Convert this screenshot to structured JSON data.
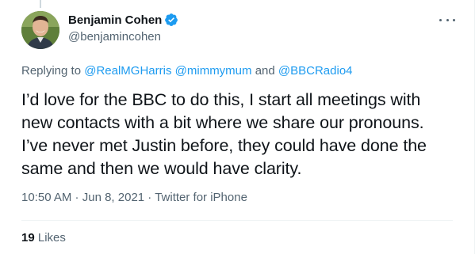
{
  "tweet": {
    "author": {
      "display_name": "Benjamin Cohen",
      "handle": "@benjamincohen",
      "verified": true
    },
    "replying_to": {
      "prefix": "Replying to ",
      "mentions": [
        "@RealMGHarris",
        "@mimmymum",
        "@BBCRadio4"
      ],
      "separator": " ",
      "conjunction": " and "
    },
    "text_lines": [
      "I’d love for the BBC to do this, I start all meetings with",
      "new contacts with a bit where we share our pronouns.",
      "I’ve never met Justin before, they could have done the",
      "same and then we would have clarity."
    ],
    "time": "10:50 AM",
    "date": "Jun 8, 2021",
    "dot": " · ",
    "source": "Twitter for iPhone",
    "likes_count": "19",
    "likes_label": " Likes",
    "colors": {
      "accent": "#1d9bf0",
      "text": "#0f1419",
      "secondary": "#536471"
    },
    "icons": {
      "verified": "verified-badge-icon",
      "more": "more-dots-icon"
    }
  }
}
